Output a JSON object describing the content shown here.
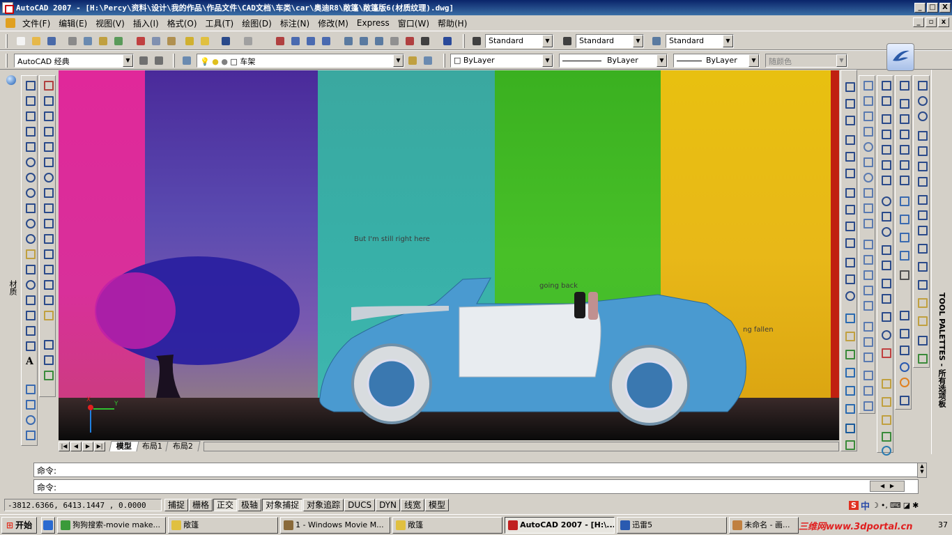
{
  "window": {
    "title": "AutoCAD 2007 - [H:\\Percy\\资料\\设计\\我的作品\\作品文件\\CAD文档\\车类\\car\\奥迪R8\\敞篷\\敞篷版6(材质纹理).dwg]",
    "min": "_",
    "max": "□",
    "close": "X"
  },
  "menu": [
    "文件(F)",
    "编辑(E)",
    "视图(V)",
    "插入(I)",
    "格式(O)",
    "工具(T)",
    "绘图(D)",
    "标注(N)",
    "修改(M)",
    "Express",
    "窗口(W)",
    "帮助(H)"
  ],
  "styles": {
    "text": "Standard",
    "dim": "Standard",
    "table": "Standard"
  },
  "workspace": "AutoCAD 经典",
  "layer": "车架",
  "props": {
    "color": "ByLayer",
    "linetype": "ByLayer",
    "lineweight": "ByLayer",
    "plotstyle": "随颜色"
  },
  "viewport": {
    "text1": "But I'm still right here",
    "text2": "going back",
    "text3": "ng fallen",
    "axis_x": "X",
    "axis_y": "Y"
  },
  "side_labels": {
    "left": "材质",
    "right": "TOOL PALETTES - 所有选项板"
  },
  "tabs": [
    "模型",
    "布局1",
    "布局2"
  ],
  "command": {
    "line1": "命令:",
    "line2": "命令:"
  },
  "status": {
    "coords": "-3812.6366,  6413.1447 , 0.0000",
    "buttons": [
      "捕捉",
      "栅格",
      "正交",
      "极轴",
      "对象捕捉",
      "对象追踪",
      "DUCS",
      "DYN",
      "线宽",
      "模型"
    ]
  },
  "taskbar": {
    "start": "开始",
    "tasks": [
      "狗狗搜索-movie make...",
      "敞篷",
      "1 - Windows Movie M...",
      "敞篷",
      "AutoCAD 2007 - [H:\\...",
      "迅雷5",
      "未命名 - 画..."
    ],
    "tray_ime": "中",
    "watermark": "三维网www.3dportal.cn",
    "clock": "37"
  }
}
